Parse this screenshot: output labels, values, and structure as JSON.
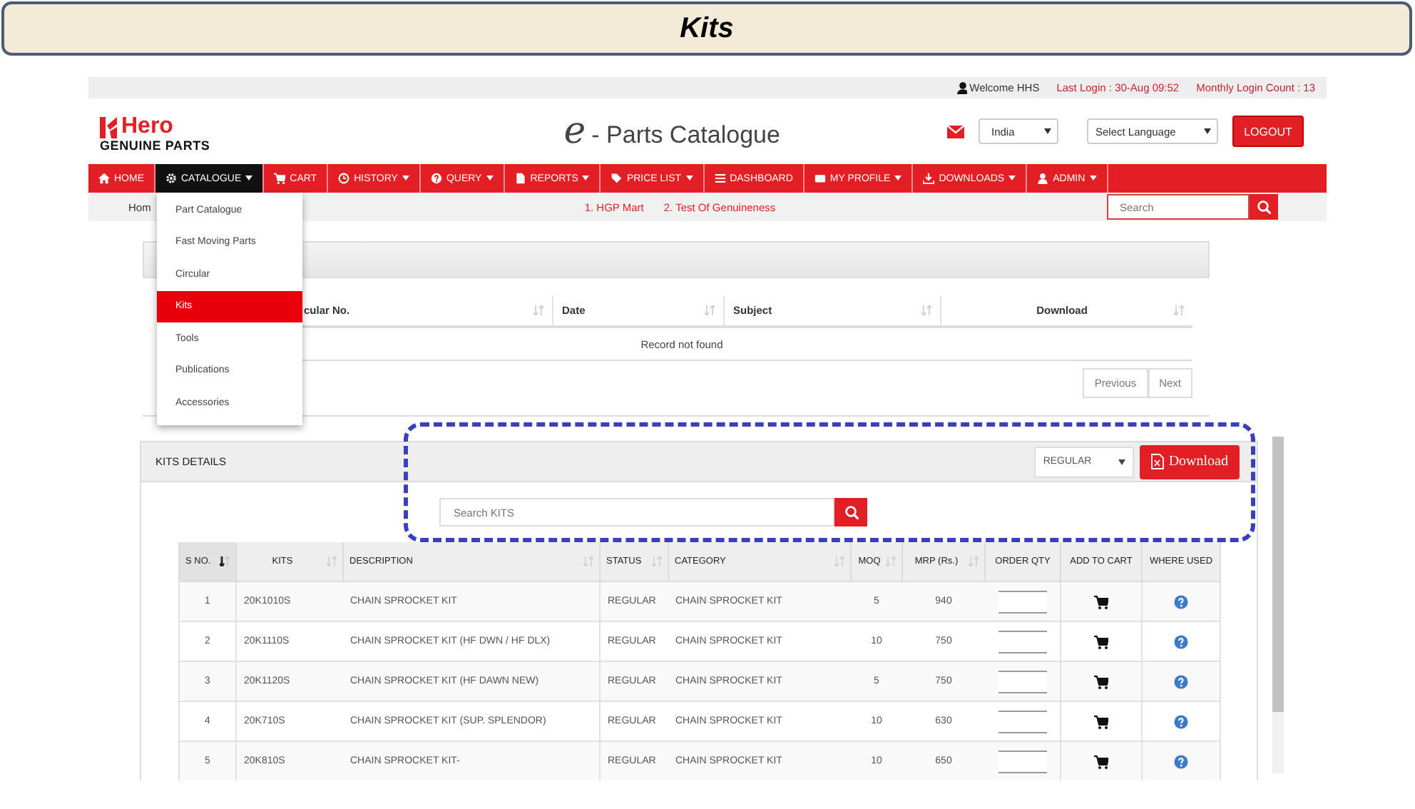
{
  "slide": {
    "title": "Kits"
  },
  "top_bar": {
    "welcome": "Welcome HHS",
    "last_login": "Last Login : 30-Aug 09:52",
    "login_count": "Monthly Login Count : 13"
  },
  "header": {
    "logo_name": "Hero",
    "logo_tagline": "GENUINE PARTS",
    "app_title_letter": "e",
    "app_title": "- Parts Catalogue",
    "country": "India",
    "language": "Select Language",
    "logout": "LOGOUT"
  },
  "nav": [
    {
      "label": "HOME",
      "selected": false,
      "has_menu": false
    },
    {
      "label": "CATALOGUE",
      "selected": true,
      "has_menu": true
    },
    {
      "label": "CART",
      "selected": false,
      "has_menu": false
    },
    {
      "label": "HISTORY",
      "selected": false,
      "has_menu": true
    },
    {
      "label": "QUERY",
      "selected": false,
      "has_menu": true
    },
    {
      "label": "REPORTS",
      "selected": false,
      "has_menu": true
    },
    {
      "label": "PRICE LIST",
      "selected": false,
      "has_menu": true
    },
    {
      "label": "DASHBOARD",
      "selected": false,
      "has_menu": false
    },
    {
      "label": "MY PROFILE",
      "selected": false,
      "has_menu": true
    },
    {
      "label": "DOWNLOADS",
      "selected": false,
      "has_menu": true
    },
    {
      "label": "ADMIN",
      "selected": false,
      "has_menu": true
    }
  ],
  "breadcrumb": {
    "home": "Hom",
    "links": [
      "1. HGP Mart",
      "2. Test Of Genuineness"
    ],
    "search": {
      "placeholder": "Search"
    }
  },
  "catalogue_menu": [
    {
      "label": "Part Catalogue",
      "selected": false
    },
    {
      "label": "Fast Moving Parts",
      "selected": false
    },
    {
      "label": "Circular",
      "selected": false
    },
    {
      "label": "Kits",
      "selected": true
    },
    {
      "label": "Tools",
      "selected": false
    },
    {
      "label": "Publications",
      "selected": false
    },
    {
      "label": "Accessories",
      "selected": false
    }
  ],
  "circular": {
    "columns": [
      "cular No.",
      "Date",
      "Subject",
      "Download"
    ],
    "empty_message": "Record not found",
    "pagination": [
      "Previous",
      "Next"
    ]
  },
  "kits": {
    "title": "KITS DETAILS",
    "filter": "REGULAR",
    "download": "Download",
    "search": {
      "placeholder": "Search KITS"
    },
    "columns": [
      {
        "label": "S NO.",
        "sortable": true,
        "sorted": true
      },
      {
        "label": "KITS",
        "sortable": true,
        "sorted": false
      },
      {
        "label": "DESCRIPTION",
        "sortable": true,
        "sorted": false
      },
      {
        "label": "STATUS",
        "sortable": true,
        "sorted": false
      },
      {
        "label": "CATEGORY",
        "sortable": true,
        "sorted": false
      },
      {
        "label": "MOQ",
        "sortable": true,
        "sorted": false
      },
      {
        "label": "MRP (Rs.)",
        "sortable": true,
        "sorted": false
      },
      {
        "label": "ORDER QTY",
        "sortable": false
      },
      {
        "label": "ADD TO CART",
        "sortable": false
      },
      {
        "label": "WHERE USED",
        "sortable": false
      }
    ],
    "rows": [
      [
        "1",
        "20K1010S",
        "CHAIN SPROCKET KIT",
        "REGULAR",
        "CHAIN SPROCKET KIT",
        "5",
        "940"
      ],
      [
        "2",
        "20K1110S",
        "CHAIN SPROCKET KIT (HF DWN / HF DLX)",
        "REGULAR",
        "CHAIN SPROCKET KIT",
        "10",
        "750"
      ],
      [
        "3",
        "20K1120S",
        "CHAIN SPROCKET KIT (HF DAWN NEW)",
        "REGULAR",
        "CHAIN SPROCKET KIT",
        "5",
        "750"
      ],
      [
        "4",
        "20K710S",
        "CHAIN SPROCKET KIT (SUP. SPLENDOR)",
        "REGULAR",
        "CHAIN SPROCKET KIT",
        "10",
        "630"
      ],
      [
        "5",
        "20K810S",
        "CHAIN SPROCKET KIT-",
        "REGULAR",
        "CHAIN SPROCKET KIT",
        "10",
        "650"
      ]
    ]
  }
}
